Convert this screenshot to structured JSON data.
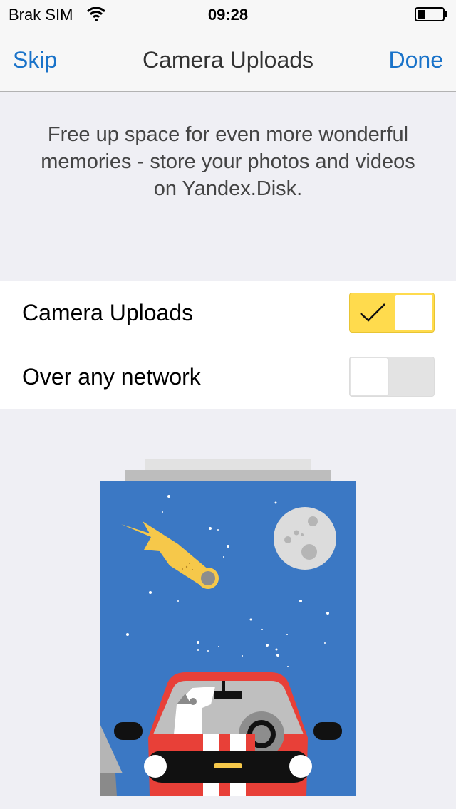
{
  "status_bar": {
    "carrier": "Brak SIM",
    "time": "09:28"
  },
  "nav": {
    "skip_label": "Skip",
    "title": "Camera Uploads",
    "done_label": "Done"
  },
  "promo_text": "Free up space for even more wonderful memories - store your photos and videos on Yandex.Disk.",
  "settings": {
    "camera_uploads": {
      "label": "Camera Uploads",
      "enabled": true
    },
    "over_any_network": {
      "label": "Over any network",
      "enabled": false
    }
  },
  "colors": {
    "accent": "#1a73c9",
    "toggle_on": "#ffdb4d",
    "sky": "#3b78c4",
    "car": "#e84038"
  }
}
